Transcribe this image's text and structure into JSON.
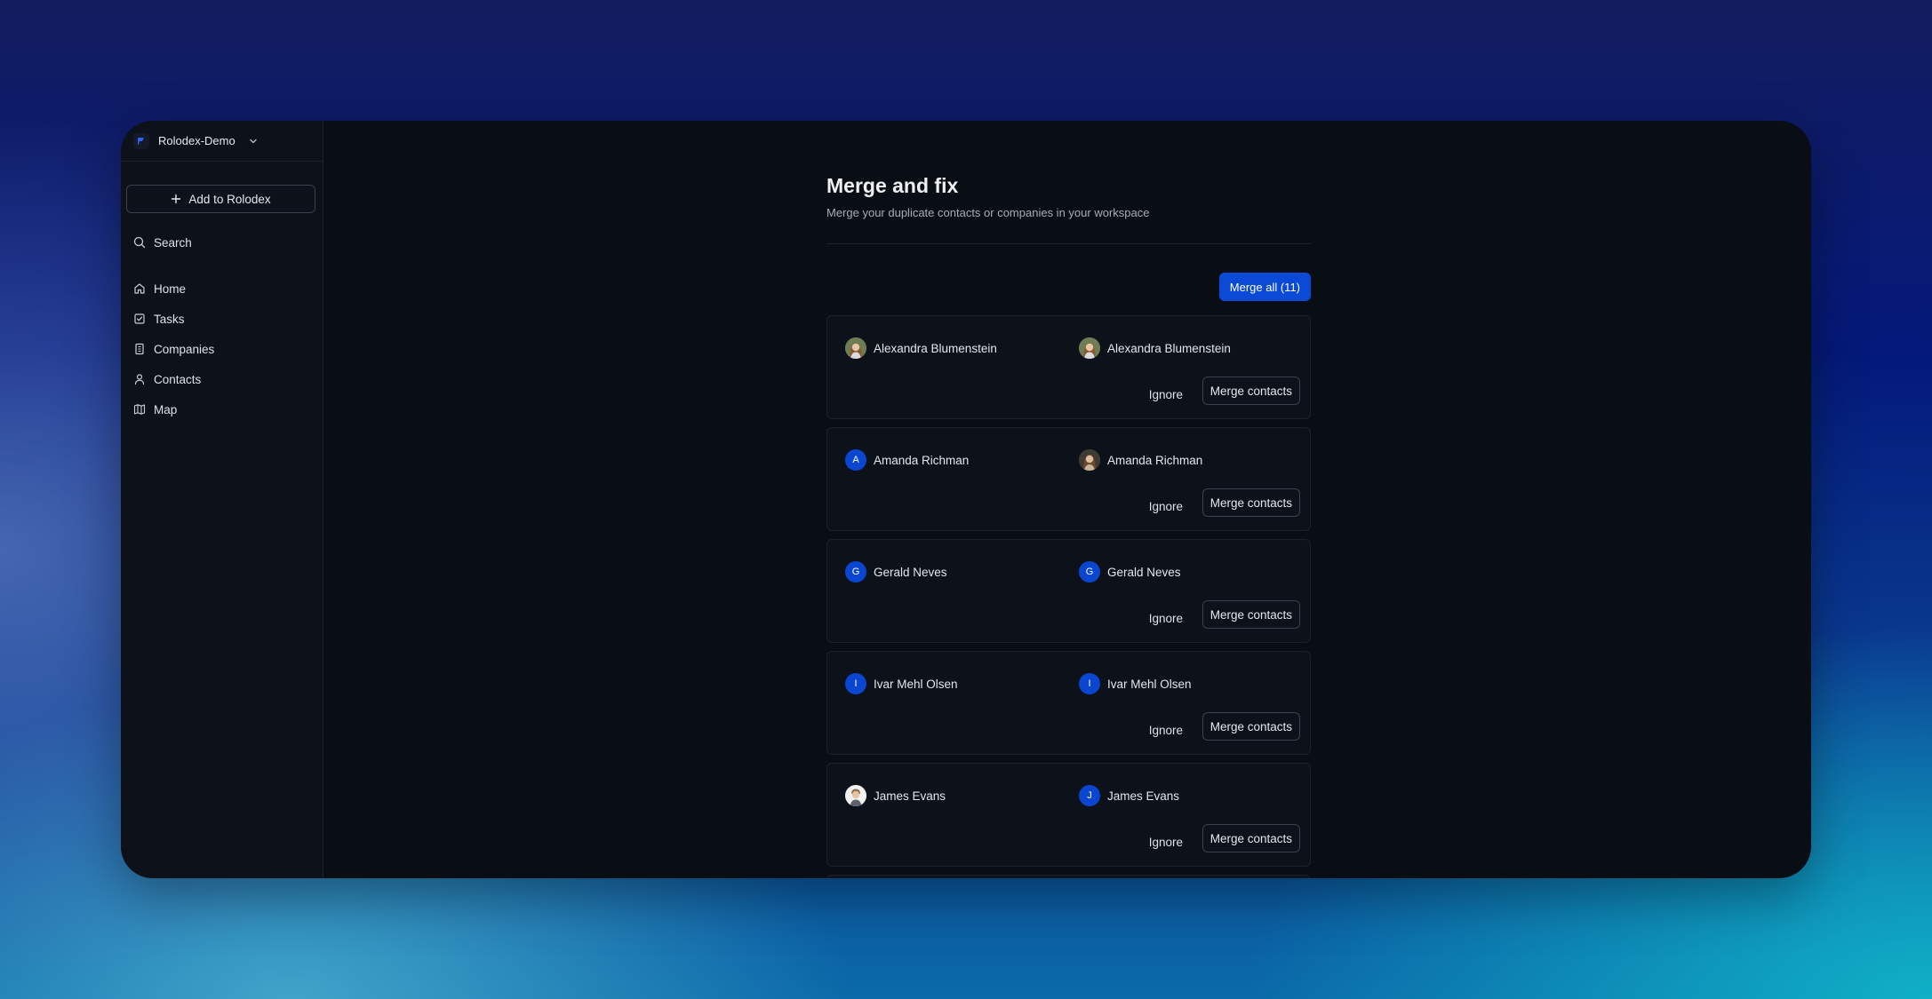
{
  "colors": {
    "accent": "#0a4ad6",
    "window_bg": "#090d14",
    "sidebar_bg": "#0d1119"
  },
  "workspace": {
    "name": "Rolodex-Demo",
    "logo_icon": "rolodex-logo-icon",
    "chevron_icon": "chevron-down-icon"
  },
  "sidebar": {
    "add_label": "Add to Rolodex",
    "search_label": "Search",
    "items": [
      {
        "label": "Home",
        "icon": "home-icon"
      },
      {
        "label": "Tasks",
        "icon": "tasks-icon"
      },
      {
        "label": "Companies",
        "icon": "building-icon"
      },
      {
        "label": "Contacts",
        "icon": "user-icon"
      },
      {
        "label": "Map",
        "icon": "map-icon"
      }
    ]
  },
  "page": {
    "title": "Merge and fix",
    "subtitle": "Merge your duplicate contacts or companies in your workspace",
    "merge_all_label": "Merge all (11)"
  },
  "actions": {
    "ignore_label": "Ignore",
    "merge_label": "Merge contacts"
  },
  "duplicates": [
    {
      "left": {
        "name": "Alexandra Blumenstein",
        "initial": ""
      },
      "right": {
        "name": "Alexandra Blumenstein",
        "initial": ""
      }
    },
    {
      "left": {
        "name": "Amanda Richman",
        "initial": "A"
      },
      "right": {
        "name": "Amanda Richman",
        "initial": ""
      }
    },
    {
      "left": {
        "name": "Gerald Neves",
        "initial": "G"
      },
      "right": {
        "name": "Gerald Neves",
        "initial": "G"
      }
    },
    {
      "left": {
        "name": "Ivar Mehl Olsen",
        "initial": "I"
      },
      "right": {
        "name": "Ivar Mehl Olsen",
        "initial": "I"
      }
    },
    {
      "left": {
        "name": "James Evans",
        "initial": ""
      },
      "right": {
        "name": "James Evans",
        "initial": "J"
      }
    }
  ]
}
